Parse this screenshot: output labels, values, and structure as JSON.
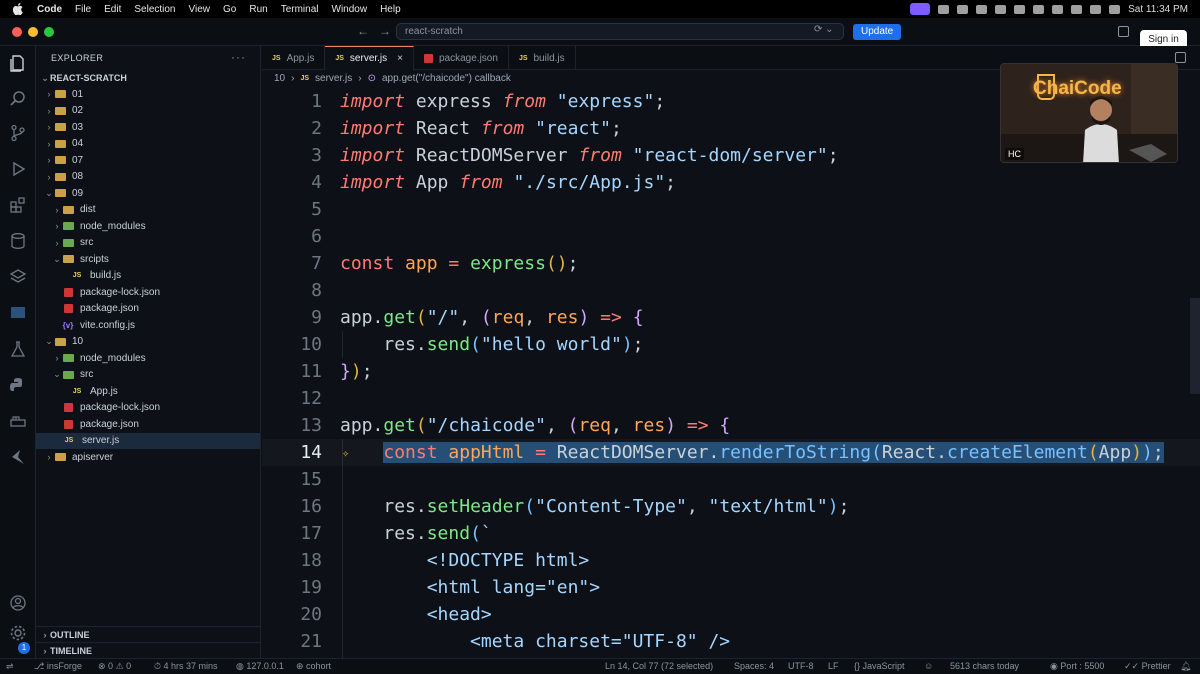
{
  "menubar": {
    "items": [
      "Code",
      "File",
      "Edit",
      "Selection",
      "View",
      "Go",
      "Run",
      "Terminal",
      "Window",
      "Help"
    ],
    "clock": "Sat 11:34 PM"
  },
  "titlebar": {
    "search_text": "react-scratch",
    "update_label": "Update",
    "signin_label": "Sign in",
    "colors": {
      "close": "#ff5f57",
      "minimize": "#febc2e",
      "zoom": "#28c840"
    }
  },
  "sidebar": {
    "title": "EXPLORER",
    "project": "REACT-SCRATCH",
    "items": [
      {
        "label": "01",
        "depth": 0,
        "type": "folder",
        "open": false
      },
      {
        "label": "02",
        "depth": 0,
        "type": "folder",
        "open": false
      },
      {
        "label": "03",
        "depth": 0,
        "type": "folder",
        "open": false
      },
      {
        "label": "04",
        "depth": 0,
        "type": "folder",
        "open": false
      },
      {
        "label": "07",
        "depth": 0,
        "type": "folder",
        "open": false
      },
      {
        "label": "08",
        "depth": 0,
        "type": "folder",
        "open": false
      },
      {
        "label": "09",
        "depth": 0,
        "type": "folder",
        "open": true
      },
      {
        "label": "dist",
        "depth": 1,
        "type": "folder",
        "open": false
      },
      {
        "label": "node_modules",
        "depth": 1,
        "type": "folder-green",
        "open": false
      },
      {
        "label": "src",
        "depth": 1,
        "type": "folder-green",
        "open": false
      },
      {
        "label": "srcipts",
        "depth": 1,
        "type": "folder",
        "open": true
      },
      {
        "label": "build.js",
        "depth": 2,
        "type": "js"
      },
      {
        "label": "package-lock.json",
        "depth": 1,
        "type": "npm"
      },
      {
        "label": "package.json",
        "depth": 1,
        "type": "npm"
      },
      {
        "label": "vite.config.js",
        "depth": 1,
        "type": "vite"
      },
      {
        "label": "10",
        "depth": 0,
        "type": "folder",
        "open": true
      },
      {
        "label": "node_modules",
        "depth": 1,
        "type": "folder-green",
        "open": false
      },
      {
        "label": "src",
        "depth": 1,
        "type": "folder-green",
        "open": true
      },
      {
        "label": "App.js",
        "depth": 2,
        "type": "js"
      },
      {
        "label": "package-lock.json",
        "depth": 1,
        "type": "npm"
      },
      {
        "label": "package.json",
        "depth": 1,
        "type": "npm"
      },
      {
        "label": "server.js",
        "depth": 1,
        "type": "js",
        "active": true
      },
      {
        "label": "apiserver",
        "depth": 0,
        "type": "folder",
        "open": false
      }
    ],
    "outline": "OUTLINE",
    "timeline": "TIMELINE"
  },
  "tabs": [
    {
      "label": "App.js",
      "icon": "js",
      "active": false
    },
    {
      "label": "server.js",
      "icon": "js",
      "active": true
    },
    {
      "label": "package.json",
      "icon": "npm",
      "active": false
    },
    {
      "label": "build.js",
      "icon": "js",
      "active": false
    }
  ],
  "breadcrumb": {
    "folder": "10",
    "file": "server.js",
    "symbol": "app.get(\"/chaicode\") callback"
  },
  "editor": {
    "current_line": 14,
    "lines": [
      {
        "n": "1",
        "html": "<span class='kw'>import</span> <span class='id'>express</span> <span class='kw'>from</span> <span class='str'>\"express\"</span><span class='pun'>;</span>"
      },
      {
        "n": "2",
        "html": "<span class='kw'>import</span> <span class='id'>React</span> <span class='kw'>from</span> <span class='str'>\"react\"</span><span class='pun'>;</span>"
      },
      {
        "n": "3",
        "html": "<span class='kw'>import</span> <span class='id'>ReactDOMServer</span> <span class='kw'>from</span> <span class='str'>\"react-dom/server\"</span><span class='pun'>;</span>"
      },
      {
        "n": "4",
        "html": "<span class='kw'>import</span> <span class='id'>App</span> <span class='kw'>from</span> <span class='str'>\"./src/App.js\"</span><span class='pun'>;</span>"
      },
      {
        "n": "5",
        "html": ""
      },
      {
        "n": "6",
        "html": ""
      },
      {
        "n": "7",
        "html": "<span class='kw2'>const</span> <span class='orange'>app</span> <span class='kw2'>=</span> <span class='strg'>express</span><span class='par'>()</span><span class='pun'>;</span>"
      },
      {
        "n": "8",
        "html": ""
      },
      {
        "n": "9",
        "html": "<span class='id'>app</span><span class='pun'>.</span><span class='strg'>get</span><span class='par'>(</span><span class='str'>\"/\"</span><span class='pun'>,</span> <span class='fnc'>(</span><span class='orange'>req</span><span class='pun'>,</span> <span class='orange'>res</span><span class='fnc'>)</span> <span class='arrow'>=&gt;</span> <span class='fnc'>{</span>"
      },
      {
        "n": "10",
        "html": "    <span class='id'>res</span><span class='pun'>.</span><span class='strg'>send</span><span class='fn'>(</span><span class='str'>\"hello world\"</span><span class='fn'>)</span><span class='pun'>;</span>"
      },
      {
        "n": "11",
        "html": "<span class='fnc'>}</span><span class='par'>)</span><span class='pun'>;</span>"
      },
      {
        "n": "12",
        "html": ""
      },
      {
        "n": "13",
        "html": "<span class='id'>app</span><span class='pun'>.</span><span class='strg'>get</span><span class='par'>(</span><span class='str'>\"/chaicode\"</span><span class='pun'>,</span> <span class='fnc'>(</span><span class='orange'>req</span><span class='pun'>,</span> <span class='orange'>res</span><span class='fnc'>)</span> <span class='arrow'>=&gt;</span> <span class='fnc'>{</span>"
      },
      {
        "n": "14",
        "html": "    <span class='sel'><span class='kw2'>const</span> <span class='orange'>appHtml</span> <span class='kw2'>=</span> <span class='id'>ReactDOMServer</span><span class='pun'>.</span><span class='fn'>renderToString</span><span class='fn'>(</span><span class='id'>React</span><span class='pun'>.</span><span class='fn'>createElement</span><span class='par'>(</span><span class='id'>App</span><span class='par'>)</span><span class='fn'>)</span><span class='pun'>;</span></span>"
      },
      {
        "n": "15",
        "html": ""
      },
      {
        "n": "16",
        "html": "    <span class='id'>res</span><span class='pun'>.</span><span class='strg'>setHeader</span><span class='fn'>(</span><span class='str'>\"Content-Type\"</span><span class='pun'>,</span> <span class='str'>\"text/html\"</span><span class='fn'>)</span><span class='pun'>;</span>"
      },
      {
        "n": "17",
        "html": "    <span class='id'>res</span><span class='pun'>.</span><span class='strg'>send</span><span class='fn'>(</span><span class='str'>`</span>"
      },
      {
        "n": "18",
        "html": "<span class='str'>        &lt;!DOCTYPE html&gt;</span>"
      },
      {
        "n": "19",
        "html": "<span class='str'>        &lt;html lang=\"en\"&gt;</span>"
      },
      {
        "n": "20",
        "html": "<span class='str'>        &lt;head&gt;</span>"
      },
      {
        "n": "21",
        "html": "<span class='str'>            &lt;meta charset=\"UTF-8\" /&gt;</span>"
      }
    ]
  },
  "webcam": {
    "logo_text": "ChaiCode",
    "badge": "HC"
  },
  "statusbar": {
    "branch": "insForge",
    "errors": "0",
    "warnings": "0",
    "time_spent": "4 hrs 37 mins",
    "host": "127.0.0.1",
    "theme": "cohort",
    "position": "Ln 14, Col 77 (72 selected)",
    "spaces": "Spaces: 4",
    "encoding": "UTF-8",
    "eol": "LF",
    "language": "JavaScript",
    "chars": "5613 chars today",
    "port": "Port : 5500",
    "prettier": "Prettier",
    "accounts_badge": "1"
  }
}
